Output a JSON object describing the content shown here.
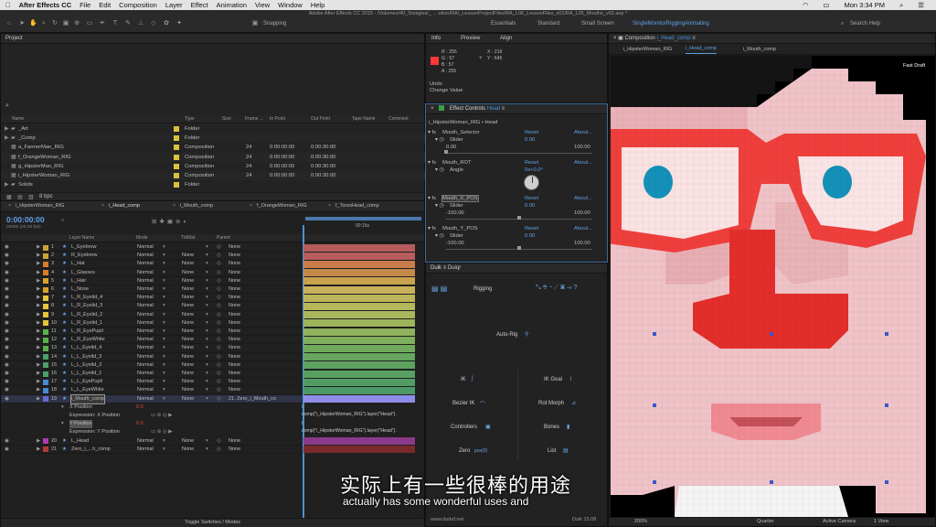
{
  "menubar": {
    "app": "After Effects CC",
    "items": [
      "File",
      "Edit",
      "Composition",
      "Layer",
      "Effect",
      "Animation",
      "View",
      "Window",
      "Help"
    ],
    "time": "Mon 3:34 PM"
  },
  "window": {
    "title": "Adobe After Effects CC 2015 - /Volumes/40_Snoigles/_ ... otion/RA/_LessonProjectFiles/RA_L06_LessonFiles_v01/RA_L05_Mouths_v02.aep *"
  },
  "toolbar": {
    "snapping": "Snapping",
    "workspaces": [
      "Essentials",
      "Standard",
      "Small Screen",
      "SingleMonitorRiggingAnimating"
    ],
    "search": "Search Help"
  },
  "project": {
    "title": "Project",
    "columns": [
      "Name",
      "Type",
      "Size",
      "Frame ...",
      "In Point",
      "Out Point",
      "Tape Name",
      "Comment"
    ],
    "items": [
      {
        "name": "_Art",
        "type": "Folder",
        "fps": "",
        "in": "",
        "out": "",
        "color": "#d8c23a"
      },
      {
        "name": "_Comp",
        "type": "Folder",
        "fps": "",
        "in": "",
        "out": "",
        "color": "#d8c23a"
      },
      {
        "name": "a_FarmerMan_RIG",
        "type": "Composition",
        "fps": "24",
        "in": "0:00:00:00",
        "out": "0:00:30:00",
        "color": "#d8c23a"
      },
      {
        "name": "f_OrangeWoman_RIG",
        "type": "Composition",
        "fps": "24",
        "in": "0:00:00:00",
        "out": "0:00:30:00",
        "color": "#d8c23a"
      },
      {
        "name": "g_HipsterMan_RIG",
        "type": "Composition",
        "fps": "24",
        "in": "0:00:00:00",
        "out": "0:00:30:00",
        "color": "#d8c23a"
      },
      {
        "name": "i_HipsterWoman_RIG",
        "type": "Composition",
        "fps": "24",
        "in": "0:00:00:00",
        "out": "0:00:30:00",
        "color": "#d8c23a"
      },
      {
        "name": "Solids",
        "type": "Folder",
        "fps": "",
        "in": "",
        "out": "",
        "color": "#d8c23a"
      }
    ],
    "bpc": "8 bpc"
  },
  "info": {
    "tabs": [
      "Info",
      "Preview",
      "Align"
    ],
    "r": "R : 255",
    "g": "G : 57",
    "b": "B : 57",
    "a": "A : 255",
    "x": "X : 216",
    "y": "Y : 645",
    "undo": "Undo",
    "undo_action": "Change Value"
  },
  "effects": {
    "title": "Effect Controls",
    "layer": "Head",
    "path": "i_HipsterWoman_RIG • Head",
    "items": [
      {
        "name": "Mouth_Selector",
        "reset": "Reset",
        "about": "About...",
        "param": "Slider",
        "value": "0.00",
        "min": "0.00",
        "max": "100.00"
      },
      {
        "name": "Mouth_ROT",
        "reset": "Reset",
        "about": "About...",
        "param": "Angle",
        "value": "0x+0.0°",
        "min": "",
        "max": ""
      },
      {
        "name": "Mouth_X_POS",
        "reset": "Reset",
        "about": "About...",
        "param": "Slider",
        "value": "0.00",
        "min": "-100.00",
        "max": "100.00"
      },
      {
        "name": "Mouth_Y_POS",
        "reset": "Reset",
        "about": "About...",
        "param": "Slider",
        "value": "0.00",
        "min": "-100.00",
        "max": "100.00"
      }
    ]
  },
  "timeline": {
    "tabs": [
      "i_HipsterWoman_RIG",
      "i_Head_comp",
      "i_Mouth_comp",
      "f_OrangeWoman_RIG",
      "f_TorsoHead_comp"
    ],
    "timecode": "0:00:00:00",
    "fps": "00000 (24.00 fps)",
    "marker": "00:15s",
    "headers": {
      "name": "Layer Name",
      "mode": "Mode",
      "trkmat": "TrkMat",
      "parent": "Parent"
    },
    "layers": [
      {
        "n": "1",
        "name": "L_Eyebrow",
        "mode": "Normal",
        "trk": "",
        "parent": "None",
        "label": "#c8a23a",
        "bar": "#b75c5c"
      },
      {
        "n": "2",
        "name": "R_Eyebrow",
        "mode": "Normal",
        "trk": "None",
        "parent": "None",
        "label": "#c8a23a",
        "bar": "#b75c5c"
      },
      {
        "n": "3",
        "name": "L_Hat",
        "mode": "Normal",
        "trk": "None",
        "parent": "None",
        "label": "#d97b2a",
        "bar": "#c87c4c"
      },
      {
        "n": "4",
        "name": "L_Glasses",
        "mode": "Normal",
        "trk": "None",
        "parent": "None",
        "label": "#d97b2a",
        "bar": "#c48a4a"
      },
      {
        "n": "5",
        "name": "L_Hair",
        "mode": "Normal",
        "trk": "None",
        "parent": "None",
        "label": "#d9a12a",
        "bar": "#c9a24d"
      },
      {
        "n": "6",
        "name": "L_Nose",
        "mode": "Normal",
        "trk": "None",
        "parent": "None",
        "label": "#d9a12a",
        "bar": "#c9b05a"
      },
      {
        "n": "7",
        "name": "L_R_Eyelid_4",
        "mode": "Normal",
        "trk": "None",
        "parent": "None",
        "label": "#e3c63a",
        "bar": "#bdb45a"
      },
      {
        "n": "8",
        "name": "L_R_Eyelid_3",
        "mode": "Normal",
        "trk": "None",
        "parent": "None",
        "label": "#e3c63a",
        "bar": "#b6b85c"
      },
      {
        "n": "9",
        "name": "L_R_Eyelid_2",
        "mode": "Normal",
        "trk": "None",
        "parent": "None",
        "label": "#e3c63a",
        "bar": "#a9b65c"
      },
      {
        "n": "10",
        "name": "L_R_Eyelid_1",
        "mode": "Normal",
        "trk": "None",
        "parent": "None",
        "label": "#e3c63a",
        "bar": "#9eb45c"
      },
      {
        "n": "11",
        "name": "L_R_EyePupil",
        "mode": "Normal",
        "trk": "None",
        "parent": "None",
        "label": "#5ab04a",
        "bar": "#8fb25c"
      },
      {
        "n": "12",
        "name": "L_R_EyeWhite",
        "mode": "Normal",
        "trk": "None",
        "parent": "None",
        "label": "#5ab04a",
        "bar": "#7fae5c"
      },
      {
        "n": "13",
        "name": "L_L_Eyelid_4",
        "mode": "Normal",
        "trk": "None",
        "parent": "None",
        "label": "#5ab04a",
        "bar": "#6faa5c"
      },
      {
        "n": "14",
        "name": "L_L_Eyelid_3",
        "mode": "Normal",
        "trk": "None",
        "parent": "None",
        "label": "#4aa06a",
        "bar": "#66a65e"
      },
      {
        "n": "15",
        "name": "L_L_Eyelid_2",
        "mode": "Normal",
        "trk": "None",
        "parent": "None",
        "label": "#4aa06a",
        "bar": "#5ea260"
      },
      {
        "n": "16",
        "name": "L_L_Eyelid_1",
        "mode": "Normal",
        "trk": "None",
        "parent": "None",
        "label": "#4aa06a",
        "bar": "#58a062"
      },
      {
        "n": "17",
        "name": "L_L_EyePupil",
        "mode": "Normal",
        "trk": "None",
        "parent": "None",
        "label": "#4a8ad0",
        "bar": "#529c64"
      },
      {
        "n": "18",
        "name": "L_L_EyeWhite",
        "mode": "Normal",
        "trk": "None",
        "parent": "None",
        "label": "#4a8ad0",
        "bar": "#4d9866"
      },
      {
        "n": "19",
        "name": "i_Mouth_comp",
        "mode": "Normal",
        "trk": "None",
        "parent": "21. Zero_i_Mouth_co",
        "label": "#6a6ad0",
        "bar": "#8e8ee8"
      }
    ],
    "props": [
      {
        "name": "X Position",
        "value": "0.0",
        "expr_label": "Expression: X Position",
        "expr": "comp(\"i_HipsterWoman_RIG\").layer(\"Head\")."
      },
      {
        "name": "Y Position",
        "value": "0.0",
        "expr_label": "Expression: Y Position",
        "expr": "comp(\"i_HipsterWoman_RIG\").layer(\"Head\")."
      }
    ],
    "bottom_layers": [
      {
        "n": "20",
        "name": "L_Head",
        "mode": "Normal",
        "trk": "None",
        "parent": "None",
        "label": "#b03ab0",
        "bar": "#8a3a8a"
      },
      {
        "n": "21",
        "name": "Zero_i_...h_comp",
        "mode": "Normal",
        "trk": "None",
        "parent": "None",
        "label": "#b03a3a",
        "bar": "#7a2a2a"
      }
    ],
    "toggle": "Toggle Switches / Modes"
  },
  "duik": {
    "tabs": [
      "Duik",
      "Duiqr"
    ],
    "rigging": "Rigging",
    "autorig": "Auto-Rig",
    "ik": "IK",
    "ikgoal": "IK Goal",
    "bezier": "Bezier IK",
    "rotmorph": "Rot Morph",
    "controllers": "Controllers",
    "bones": "Bones",
    "zero": "Zero",
    "list": "List",
    "site": "www.duduf.net",
    "version": "Duik 15.08"
  },
  "composition": {
    "title": "Composition",
    "name": "i_Head_comp",
    "tabs": [
      "i_HipsterWoman_RIG",
      "i_Head_comp",
      "i_Mouth_comp"
    ],
    "quality": "Fast Draft",
    "zoom": "200%",
    "resolution": "Quarter",
    "camera": "Active Camera",
    "view": "1 View"
  },
  "subtitle": {
    "zh": "实际上有一些很棒的用途",
    "en": "actually has some wonderful uses and"
  }
}
